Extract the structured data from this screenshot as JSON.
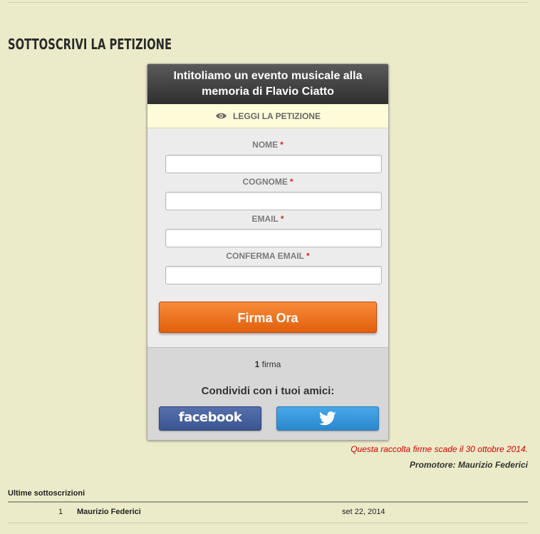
{
  "section_title": "SOTTOSCRIVI LA PETIZIONE",
  "petition": {
    "title_line1": "Intitoliamo un evento musicale alla",
    "title_line2": "memoria di Flavio Ciatto",
    "read_label": "LEGGI LA PETIZIONE"
  },
  "form": {
    "required_mark": "*",
    "fields": [
      {
        "label": "NOME",
        "value": ""
      },
      {
        "label": "COGNOME",
        "value": ""
      },
      {
        "label": "EMAIL",
        "value": ""
      },
      {
        "label": "CONFERMA EMAIL",
        "value": ""
      }
    ],
    "submit_label": "Firma Ora"
  },
  "signatures": {
    "count": "1",
    "unit": "firma"
  },
  "share": {
    "label": "Condividi con i tuoi amici:",
    "facebook_label": "facebook",
    "twitter_icon": "twitter-bird-icon"
  },
  "expiry_text": "Questa raccolta firme scade il 30 ottobre 2014.",
  "promoter_text": "Promotore: Maurizio Federici",
  "latest": {
    "title": "Ultime sottoscrizioni",
    "rows": [
      {
        "num": "1",
        "name": "Maurizio Federici",
        "date": "set 22, 2014"
      }
    ]
  },
  "colors": {
    "background": "#ecebc9",
    "submit": "#e86d1c",
    "facebook": "#3b5593",
    "twitter": "#2a88cc",
    "required": "#d4291f",
    "expiry": "#d60000"
  }
}
